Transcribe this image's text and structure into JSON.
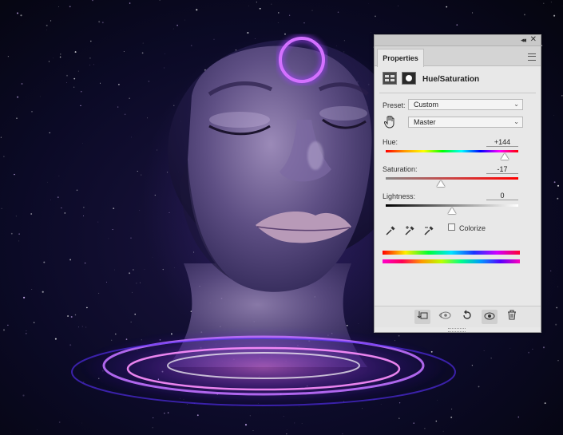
{
  "panel": {
    "tab_label": "Properties",
    "adjustment_title": "Hue/Saturation",
    "preset_label": "Preset:",
    "preset_value": "Custom",
    "channel_value": "Master",
    "hue_label": "Hue:",
    "hue_value": "+144",
    "hue_fraction": 0.9,
    "saturation_label": "Saturation:",
    "saturation_value": "-17",
    "saturation_fraction": 0.415,
    "lightness_label": "Lightness:",
    "lightness_value": "0",
    "lightness_fraction": 0.5,
    "colorize_label": "Colorize",
    "colorize_checked": false,
    "collapse_glyph": "◂◂",
    "close_glyph": "✕"
  },
  "icons": {
    "collapse": "double-chevron-icon",
    "close": "close-icon",
    "panel_menu": "panel-menu-icon",
    "adjustment": "adjustment-icon",
    "mask": "mask-icon",
    "target_adjust": "hand-target-icon",
    "eyedropper": "eyedropper-icon",
    "eyedropper_plus": "eyedropper-plus-icon",
    "eyedropper_minus": "eyedropper-minus-icon",
    "clip": "clip-to-layer-icon",
    "view_previous": "view-previous-icon",
    "reset": "reset-icon",
    "visibility": "eye-icon",
    "delete": "trash-icon"
  },
  "colors": {
    "panel_bg": "#e8e8e8",
    "halo": "#b060ff",
    "space_bg": "#0b0a26"
  }
}
